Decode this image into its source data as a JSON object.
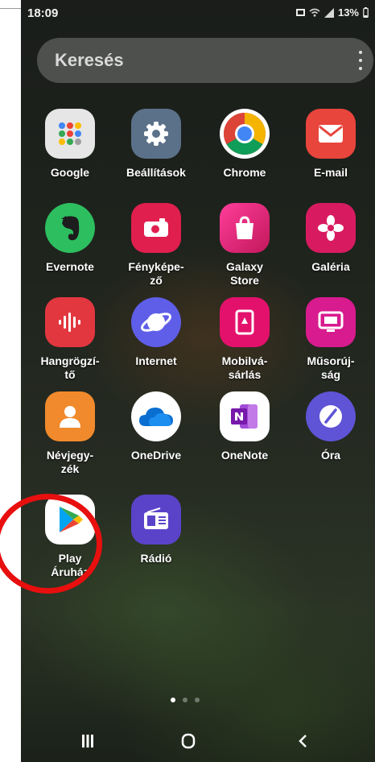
{
  "status_bar": {
    "time": "18:09",
    "battery": "13%"
  },
  "search": {
    "placeholder": "Keresés"
  },
  "apps": [
    {
      "label": "Google",
      "icon": "google-folder-icon"
    },
    {
      "label": "Beállítások",
      "icon": "gear-icon"
    },
    {
      "label": "Chrome",
      "icon": "chrome-icon"
    },
    {
      "label": "E-mail",
      "icon": "envelope-icon"
    },
    {
      "label": "Evernote",
      "icon": "evernote-icon"
    },
    {
      "label": "Fényképe-\nző",
      "icon": "camera-icon"
    },
    {
      "label": "Galaxy\nStore",
      "icon": "shopping-bag-icon"
    },
    {
      "label": "Galéria",
      "icon": "flower-icon"
    },
    {
      "label": "Hangrögzí-\ntő",
      "icon": "sound-wave-icon"
    },
    {
      "label": "Internet",
      "icon": "planet-icon"
    },
    {
      "label": "Mobilvá-\nsárlás",
      "icon": "mobile-purchase-icon"
    },
    {
      "label": "Műsorúj-\nság",
      "icon": "tv-guide-icon"
    },
    {
      "label": "Névjegy-\nzék",
      "icon": "person-icon"
    },
    {
      "label": "OneDrive",
      "icon": "cloud-icon"
    },
    {
      "label": "OneNote",
      "icon": "onenote-icon"
    },
    {
      "label": "Óra",
      "icon": "clock-icon"
    },
    {
      "label": "Play\nÁruház",
      "icon": "play-store-icon"
    },
    {
      "label": "Rádió",
      "icon": "radio-icon"
    }
  ],
  "highlight": {
    "target": "Play Áruház",
    "color": "#e80f0f"
  },
  "page_indicator": {
    "pages": 3,
    "current": 1
  },
  "nav": {
    "recents_icon": "recents-icon",
    "home_icon": "home-icon",
    "back_icon": "back-icon"
  }
}
